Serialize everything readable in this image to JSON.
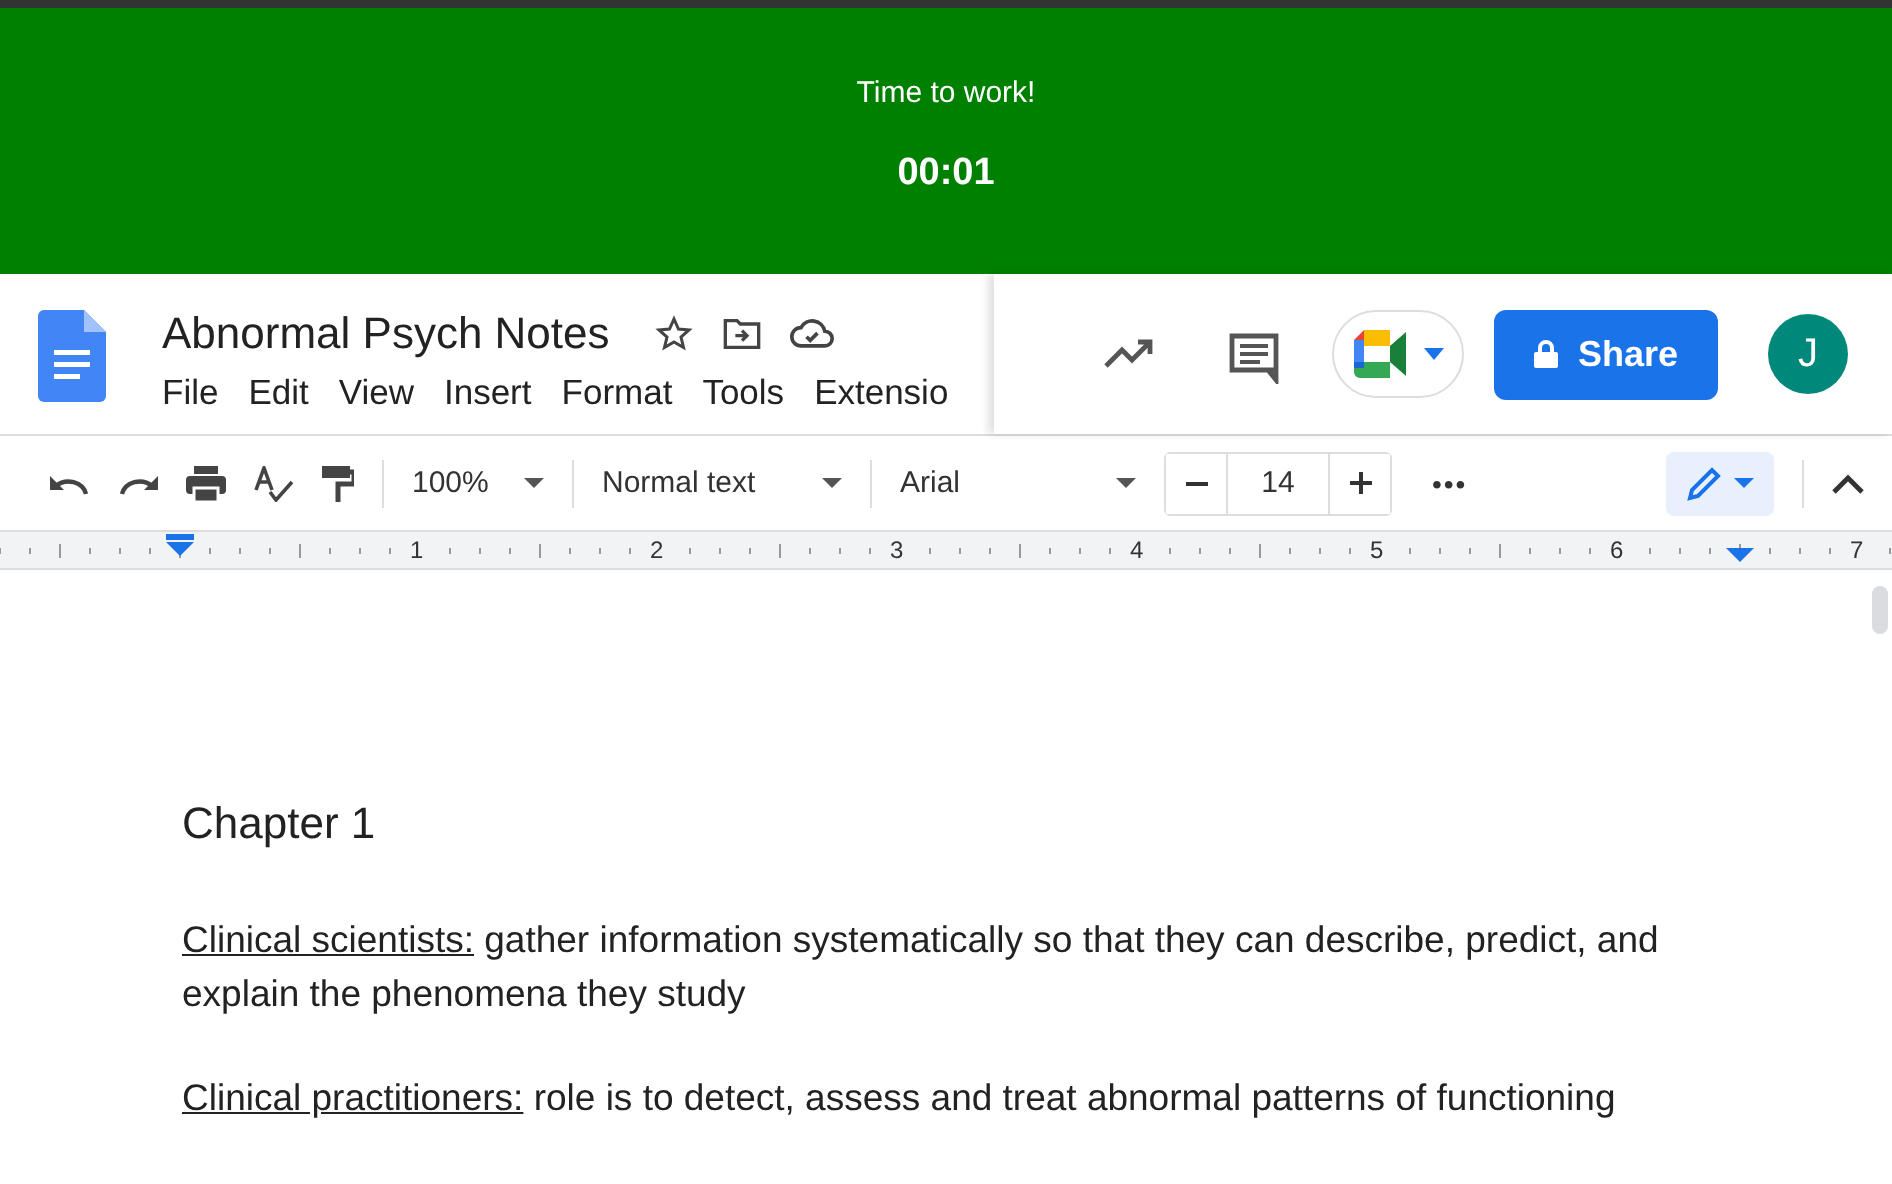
{
  "timer": {
    "message": "Time to work!",
    "time": "00:01"
  },
  "document": {
    "title": "Abnormal Psych Notes",
    "menu": [
      "File",
      "Edit",
      "View",
      "Insert",
      "Format",
      "Tools",
      "Extensio"
    ]
  },
  "share": {
    "label": "Share"
  },
  "account": {
    "initial": "J"
  },
  "toolbar": {
    "zoom": "100%",
    "style": "Normal text",
    "font": "Arial",
    "font_size": "14",
    "more": "•••"
  },
  "ruler": [
    "1",
    "2",
    "3",
    "4",
    "5",
    "6",
    "7"
  ],
  "content": {
    "heading": "Chapter 1",
    "paragraphs": [
      {
        "term": "Clinical scientists:",
        "text": " gather information systematically so that they can describe, predict, and explain the phenomena they study"
      },
      {
        "term": "Clinical practitioners:",
        "text": " role is to detect, assess and treat abnormal patterns of functioning"
      }
    ]
  }
}
